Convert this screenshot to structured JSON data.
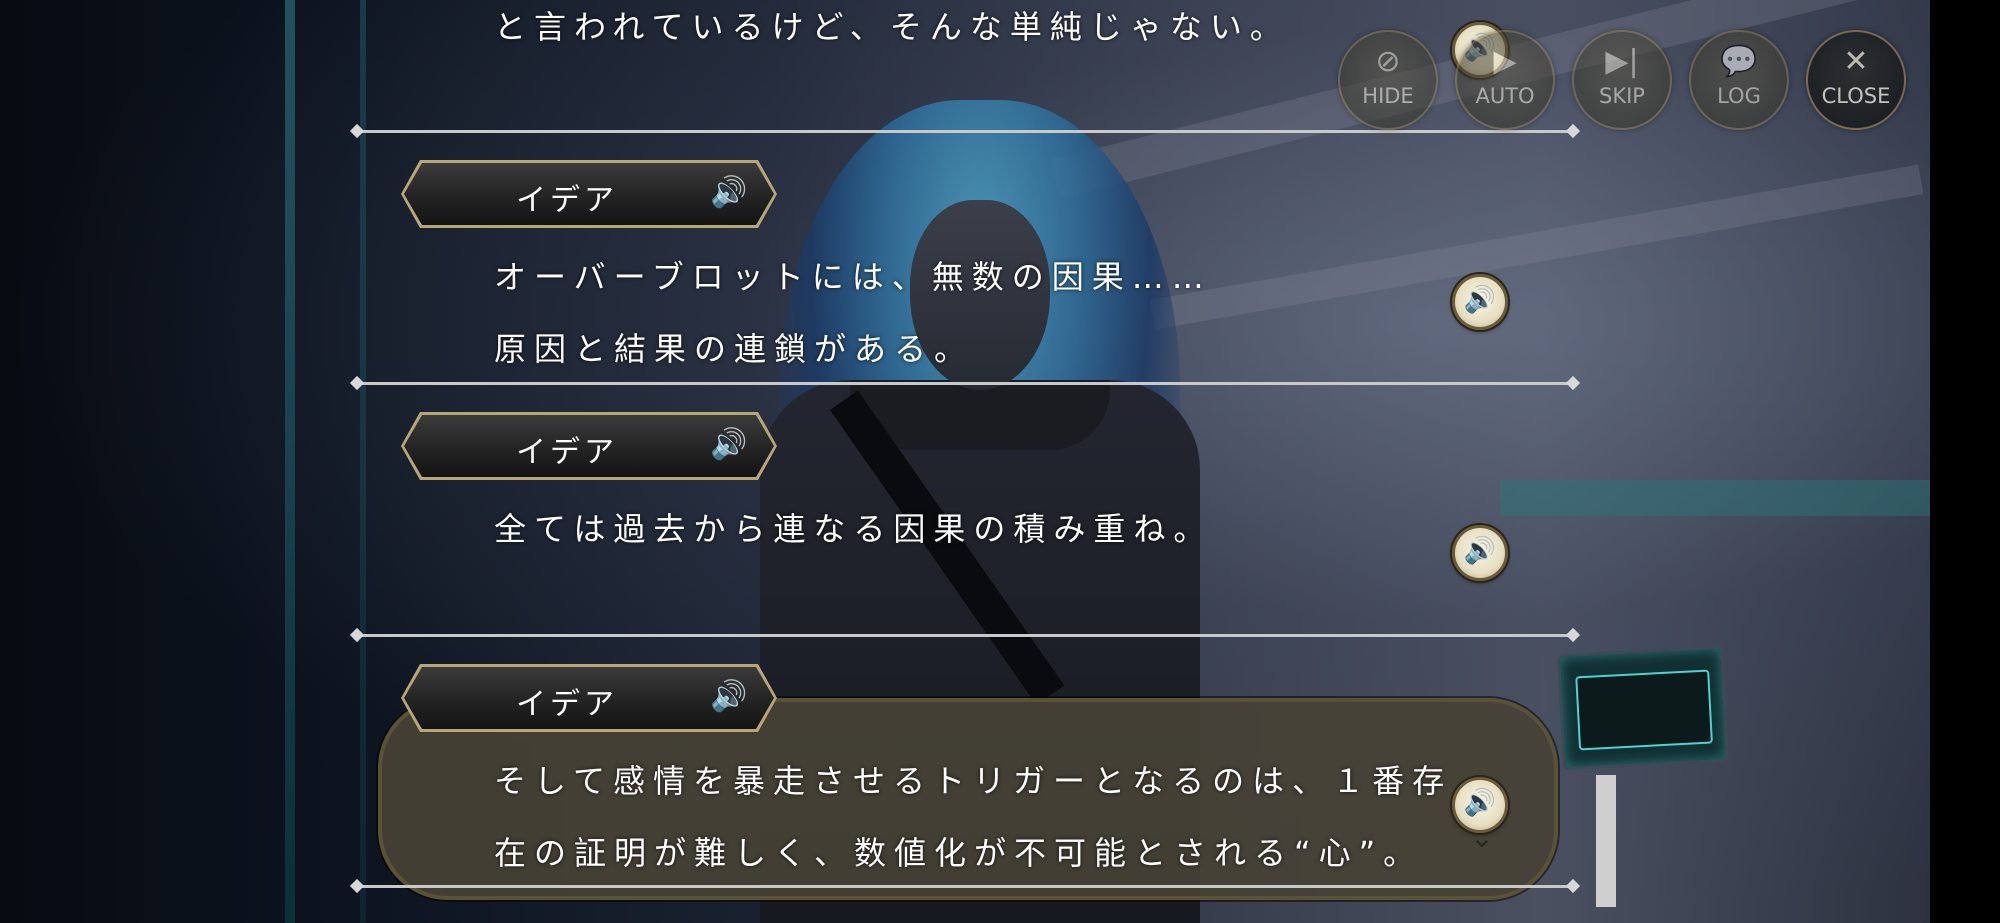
{
  "toolbar": {
    "hide": {
      "label": "HIDE",
      "icon": "eye-off-icon"
    },
    "auto": {
      "label": "AUTO",
      "icon": "play-icon"
    },
    "skip": {
      "label": "SKIP",
      "icon": "skip-forward-icon"
    },
    "log": {
      "label": "LOG",
      "icon": "chat-bubble-icon"
    },
    "close": {
      "label": "CLOSE",
      "icon": "close-icon"
    }
  },
  "log_entries": [
    {
      "speaker": "",
      "lines": [
        "と言われているけど、そんな単純じゃない。"
      ]
    },
    {
      "speaker": "イデア",
      "lines": [
        "オーバーブロットには、無数の因果……",
        "原因と結果の連鎖がある。"
      ]
    },
    {
      "speaker": "イデア",
      "lines": [
        "全ては過去から連なる因果の積み重ね。"
      ]
    },
    {
      "speaker": "イデア",
      "lines": [
        "そして感情を暴走させるトリガーとなるのは、１番存",
        "在の証明が難しく、数値化が不可能とされる“心”。"
      ],
      "current": true
    }
  ],
  "colors": {
    "accent_gold": "#b7a774",
    "dialog_bg": "#46423a",
    "text": "#ffffff"
  }
}
